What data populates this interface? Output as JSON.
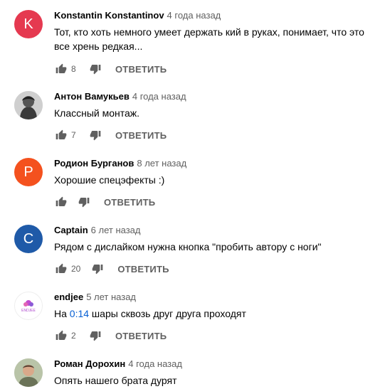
{
  "comments": [
    {
      "author": "Konstantin Konstantinov",
      "time": "4 года назад",
      "text": "Тот, кто хоть немного умеет держать кий в руках, понимает, что это все хрень редкая...",
      "likes": "8",
      "reply_label": "ОТВЕТИТЬ",
      "avatar": {
        "type": "letter",
        "letter": "K",
        "color": "#e53950"
      }
    },
    {
      "author": "Антон Вамукьев",
      "time": "4 года назад",
      "text": "Классный монтаж.",
      "likes": "7",
      "reply_label": "ОТВЕТИТЬ",
      "avatar": {
        "type": "photo"
      }
    },
    {
      "author": "Родион Бурганов",
      "time": "8 лет назад",
      "text": "Хорошие спецэфекты :)",
      "likes": "",
      "reply_label": "ОТВЕТИТЬ",
      "avatar": {
        "type": "letter",
        "letter": "Р",
        "color": "#f4511e"
      }
    },
    {
      "author": "Captain",
      "time": "6 лет назад",
      "text": "Рядом с дислайком нужна кнопка \"пробить автору с ноги\"",
      "likes": "20",
      "reply_label": "ОТВЕТИТЬ",
      "avatar": {
        "type": "letter",
        "letter": "C",
        "color": "#1f5aa8"
      }
    },
    {
      "author": "endjee",
      "time": "5 лет назад",
      "text_before": "На ",
      "timestamp_link": "0:14",
      "text_after": " шары сквозь друг друга проходят",
      "likes": "2",
      "reply_label": "ОТВЕТИТЬ",
      "avatar": {
        "type": "logo",
        "logo_text": "ENDJEE"
      }
    },
    {
      "author": "Роман Дорохин",
      "time": "4 года назад",
      "text": "Опять нашего брата дурят",
      "avatar": {
        "type": "photo"
      }
    }
  ],
  "colors": {
    "text": "#030303",
    "secondary": "#606060",
    "link": "#065fd4",
    "icon": "#606060"
  }
}
